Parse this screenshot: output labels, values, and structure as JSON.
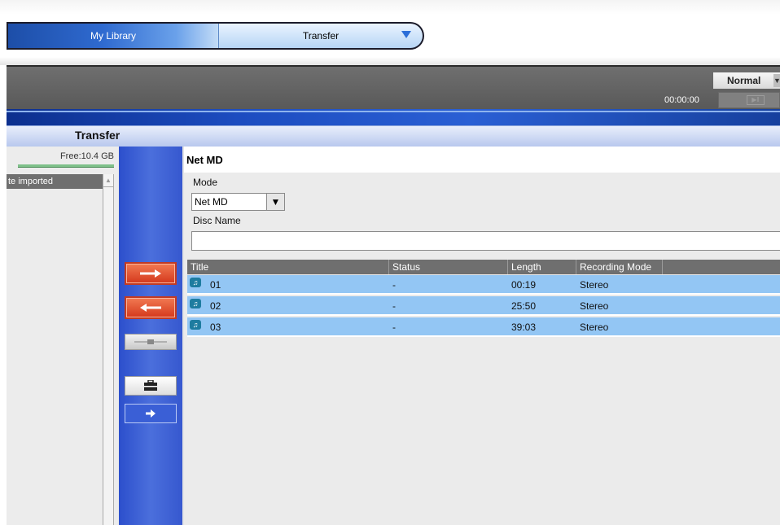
{
  "nav": {
    "library_label": "My Library",
    "transfer_label": "Transfer"
  },
  "player": {
    "playback_mode": "Normal",
    "time": "00:00:00"
  },
  "section": {
    "title": "Transfer"
  },
  "left_panel": {
    "free_space": "Free:10.4  GB",
    "list_header": "te imported"
  },
  "device": {
    "title": "Net MD",
    "mode_label": "Mode",
    "mode_value": "Net MD",
    "disc_name_label": "Disc Name",
    "disc_name_value": ""
  },
  "table": {
    "columns": [
      "Title",
      "Status",
      "Length",
      "Recording Mode"
    ],
    "rows": [
      {
        "title": "01",
        "status": "-",
        "length": "00:19",
        "mode": "Stereo"
      },
      {
        "title": "02",
        "status": "-",
        "length": "25:50",
        "mode": "Stereo"
      },
      {
        "title": "03",
        "status": "-",
        "length": "39:03",
        "mode": "Stereo"
      }
    ]
  },
  "colors": {
    "row_highlight": "#93c6f4",
    "transfer_button": "#d4381c",
    "column_blue": "#3658cf",
    "table_header": "#6f6f6f"
  },
  "icons": {
    "transfer_to_device": "arrow-right-icon",
    "transfer_from_device": "arrow-left-icon",
    "stop": "stop-icon",
    "toolbox": "toolbox-icon",
    "next": "arrow-right-small-icon",
    "track": "music-note-icon"
  }
}
